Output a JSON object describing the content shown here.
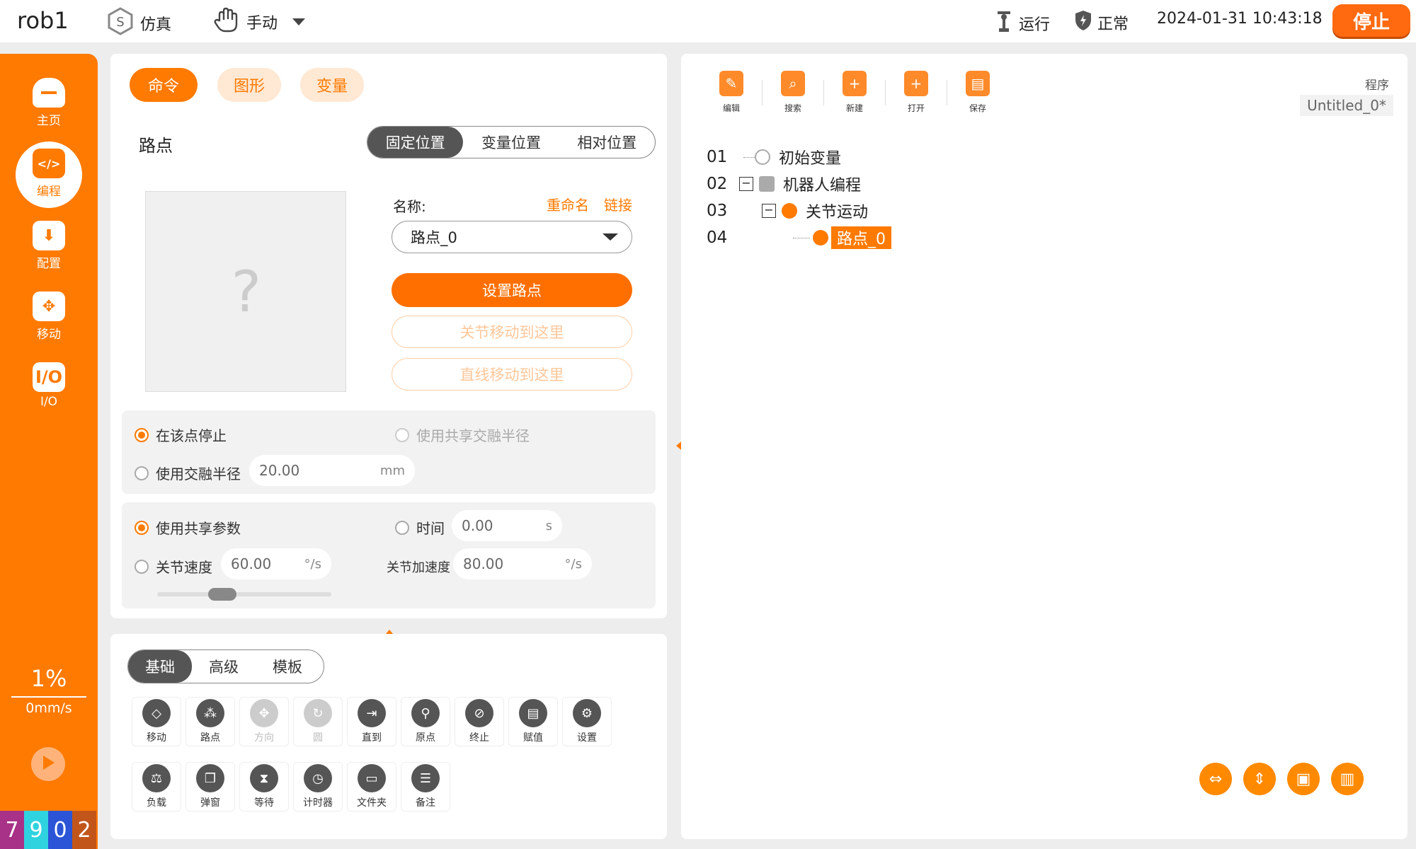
{
  "header": {
    "robot_name": "rob1",
    "sim_label": "仿真",
    "mode_label": "手动",
    "run_label": "运行",
    "status_label": "正常",
    "datetime": "2024-01-31 10:43:18",
    "stop_label": "停止"
  },
  "sidebar": {
    "items": [
      {
        "label": "主页",
        "icon": "home-icon"
      },
      {
        "label": "编程",
        "icon": "code-icon"
      },
      {
        "label": "配置",
        "icon": "download-icon"
      },
      {
        "label": "移动",
        "icon": "move-icon"
      },
      {
        "label": "I/O",
        "icon": "io-icon"
      }
    ],
    "speed_percent": "1%",
    "speed_mm": "0mm/s",
    "counter": [
      {
        "digit": "7",
        "color": "#a83287"
      },
      {
        "digit": "9",
        "color": "#2fd3e0"
      },
      {
        "digit": "0",
        "color": "#2b55d6"
      },
      {
        "digit": "2",
        "color": "#c2561a"
      }
    ]
  },
  "command_panel": {
    "tabs": [
      "命令",
      "图形",
      "变量"
    ],
    "title": "路点",
    "position_tabs": [
      "固定位置",
      "变量位置",
      "相对位置"
    ],
    "name_label": "名称:",
    "rename_link": "重命名",
    "link_link": "链接",
    "waypoint_select": "路点_0",
    "set_waypoint": "设置路点",
    "joint_move_here": "关节移动到这里",
    "linear_move_here": "直线移动到这里",
    "stop_at_point": "在该点停止",
    "use_shared_blend": "使用共享交融半径",
    "use_blend_radius": "使用交融半径",
    "blend_value": "20.00",
    "blend_unit": "mm",
    "use_shared_params": "使用共享参数",
    "time_label": "时间",
    "time_value": "0.00",
    "time_unit": "s",
    "joint_speed_label": "关节速度",
    "joint_speed_value": "60.00",
    "joint_speed_unit": "°/s",
    "joint_accel_label": "关节加速度",
    "joint_accel_value": "80.00",
    "joint_accel_unit": "°/s"
  },
  "library": {
    "tabs": [
      "基础",
      "高级",
      "模板"
    ],
    "row1": [
      {
        "label": "移动",
        "icon": "move-diamond-icon"
      },
      {
        "label": "路点",
        "icon": "waypoint-icon"
      },
      {
        "label": "方向",
        "icon": "direction-icon"
      },
      {
        "label": "圆",
        "icon": "circle-icon"
      },
      {
        "label": "直到",
        "icon": "until-icon"
      },
      {
        "label": "原点",
        "icon": "origin-icon"
      },
      {
        "label": "终止",
        "icon": "halt-icon"
      },
      {
        "label": "赋值",
        "icon": "assign-icon"
      },
      {
        "label": "设置",
        "icon": "settings-icon"
      }
    ],
    "row2": [
      {
        "label": "负载",
        "icon": "payload-icon"
      },
      {
        "label": "弹窗",
        "icon": "popup-icon"
      },
      {
        "label": "等待",
        "icon": "hourglass-icon"
      },
      {
        "label": "计时器",
        "icon": "timer-icon"
      },
      {
        "label": "文件夹",
        "icon": "folder-icon"
      },
      {
        "label": "备注",
        "icon": "comment-icon"
      }
    ]
  },
  "program": {
    "toolbar": [
      "编辑",
      "搜索",
      "新建",
      "打开",
      "保存"
    ],
    "program_label": "程序",
    "program_name": "Untitled_0*",
    "tree": [
      {
        "num": "01",
        "label": "初始变量"
      },
      {
        "num": "02",
        "label": "机器人编程"
      },
      {
        "num": "03",
        "label": "关节运动"
      },
      {
        "num": "04",
        "label": "路点_0"
      }
    ]
  },
  "colors": {
    "accent": "#ff7a00",
    "dark": "#555555"
  }
}
